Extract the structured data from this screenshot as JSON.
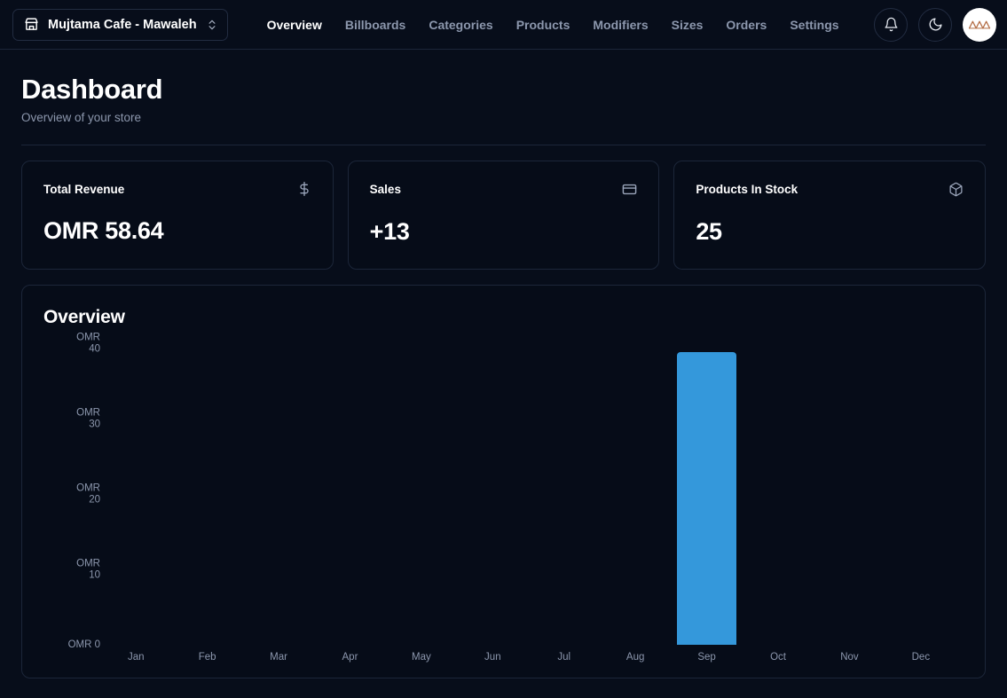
{
  "topbar": {
    "store_selector": {
      "icon": "store-icon",
      "name": "Mujtama Cafe - Mawaleh",
      "chevron": "chevrons-up-down-icon"
    },
    "nav": [
      {
        "label": "Overview",
        "active": true
      },
      {
        "label": "Billboards",
        "active": false
      },
      {
        "label": "Categories",
        "active": false
      },
      {
        "label": "Products",
        "active": false
      },
      {
        "label": "Modifiers",
        "active": false
      },
      {
        "label": "Sizes",
        "active": false
      },
      {
        "label": "Orders",
        "active": false
      },
      {
        "label": "Settings",
        "active": false
      }
    ],
    "actions": {
      "notifications": "bell-icon",
      "theme_toggle": "moon-icon",
      "avatar": "user-avatar"
    }
  },
  "page": {
    "title": "Dashboard",
    "subtitle": "Overview of your store"
  },
  "stats": [
    {
      "label": "Total Revenue",
      "value": "OMR 58.64",
      "icon": "dollar-sign-icon"
    },
    {
      "label": "Sales",
      "value": "+13",
      "icon": "credit-card-icon"
    },
    {
      "label": "Products In Stock",
      "value": "25",
      "icon": "package-icon"
    }
  ],
  "overview": {
    "title": "Overview"
  },
  "chart_data": {
    "type": "bar",
    "title": "Overview",
    "xlabel": "",
    "ylabel": "",
    "categories": [
      "Jan",
      "Feb",
      "Mar",
      "Apr",
      "May",
      "Jun",
      "Jul",
      "Aug",
      "Sep",
      "Oct",
      "Nov",
      "Dec"
    ],
    "values": [
      0,
      0,
      0,
      0,
      0,
      0,
      0,
      0,
      38.8,
      0,
      0,
      0
    ],
    "ylim": [
      0,
      40
    ],
    "yticks": [
      0,
      10,
      20,
      30,
      40
    ],
    "ytick_labels": [
      "OMR 0",
      "OMR\n10",
      "OMR\n20",
      "OMR\n30",
      "OMR\n40"
    ],
    "grid": false,
    "legend": false,
    "bar_color": "#3498db",
    "currency": "OMR"
  },
  "colors": {
    "background": "#070d1a",
    "card_background": "#060c18",
    "border": "#1c2639",
    "text_primary": "#ffffff",
    "text_muted": "#8c97ad",
    "accent": "#3498db",
    "avatar_logo": "#b5714a"
  }
}
